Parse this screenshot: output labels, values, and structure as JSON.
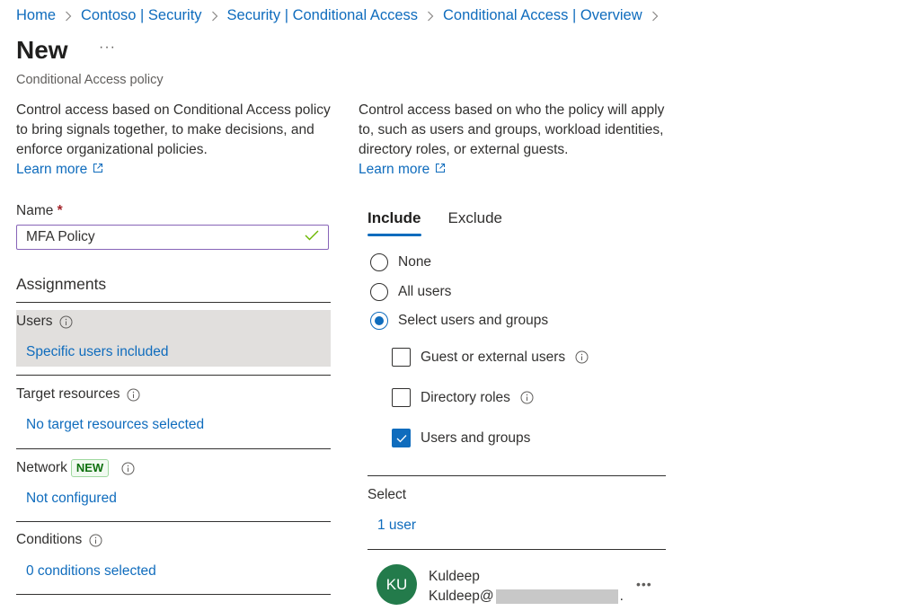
{
  "breadcrumb": [
    {
      "label": "Home"
    },
    {
      "label": "Contoso | Security"
    },
    {
      "label": "Security | Conditional Access"
    },
    {
      "label": "Conditional Access | Overview"
    }
  ],
  "header": {
    "title": "New",
    "more_label": "···",
    "subtitle": "Conditional Access policy"
  },
  "left": {
    "description": "Control access based on Conditional Access policy to bring signals together, to make decisions, and enforce organizational policies.",
    "learn_more": "Learn more",
    "name_label": "Name",
    "name_required": "*",
    "name_value": "MFA Policy",
    "assignments_heading": "Assignments",
    "sections": [
      {
        "title": "Users",
        "link": "Specific users included"
      },
      {
        "title": "Target resources",
        "link": "No target resources selected"
      },
      {
        "title": "Network",
        "badge": "NEW",
        "link": "Not configured"
      },
      {
        "title": "Conditions",
        "link": "0 conditions selected"
      }
    ]
  },
  "right": {
    "description": "Control access based on who the policy will apply to, such as users and groups, workload identities, directory roles, or external guests.",
    "learn_more": "Learn more",
    "tabs": [
      {
        "label": "Include",
        "active": true
      },
      {
        "label": "Exclude",
        "active": false
      }
    ],
    "radios": [
      {
        "label": "None",
        "checked": false
      },
      {
        "label": "All users",
        "checked": false
      },
      {
        "label": "Select users and groups",
        "checked": true
      }
    ],
    "checkboxes": [
      {
        "label": "Guest or external users",
        "checked": false,
        "info": true
      },
      {
        "label": "Directory roles",
        "checked": false,
        "info": true
      },
      {
        "label": "Users and groups",
        "checked": true,
        "info": false
      }
    ],
    "select_label": "Select",
    "select_link": "1 user",
    "selected_user": {
      "initials": "KU",
      "name": "Kuldeep",
      "email_prefix": "Kuldeep@",
      "email_suffix": ".",
      "avatar_color": "#237b4b",
      "more_label": "•••"
    }
  },
  "colors": {
    "link": "#0f6cbd",
    "input_border": "#8764b8",
    "check_green": "#6bb700",
    "selected_bg": "#e1dfdd",
    "required": "#a4262c"
  }
}
